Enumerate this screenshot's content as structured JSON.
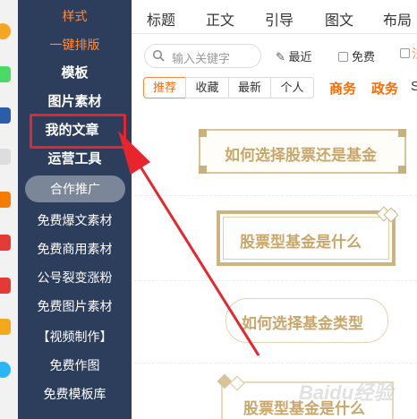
{
  "sidebar": {
    "items": [
      {
        "label": "样式"
      },
      {
        "label": "一键排版"
      },
      {
        "label": "模板"
      },
      {
        "label": "图片素材"
      },
      {
        "label": "我的文章"
      },
      {
        "label": "运营工具"
      },
      {
        "label": "合作推广"
      },
      {
        "label": "免费爆文素材"
      },
      {
        "label": "免费商用素材"
      },
      {
        "label": "公号裂变涨粉"
      },
      {
        "label": "免费图片素材"
      },
      {
        "label": "【视频制作】"
      },
      {
        "label": "免费作图"
      },
      {
        "label": "免费模板库"
      }
    ],
    "highlighted": "我的文章"
  },
  "tabs": [
    "标题",
    "正文",
    "引导",
    "图文",
    "布局"
  ],
  "search": {
    "placeholder": "输入关键字"
  },
  "toolbar": {
    "recent_label": "最近",
    "free_label": "免费",
    "extra_label": "法"
  },
  "filters": [
    "推荐",
    "收藏",
    "最新",
    "个人"
  ],
  "categories": [
    "商务",
    "政务",
    "S"
  ],
  "cards": [
    {
      "title": "如何选择股票还是基金"
    },
    {
      "title": "股票型基金是什么"
    },
    {
      "title": "如何选择基金类型"
    },
    {
      "title": "股票型基金是什么"
    }
  ],
  "watermark": "Baidu经验",
  "colors": {
    "sidebar": "#2c3e5c",
    "accent": "#ff6a00",
    "highlight": "#e8242c",
    "card_gold": "#c9a76a"
  }
}
